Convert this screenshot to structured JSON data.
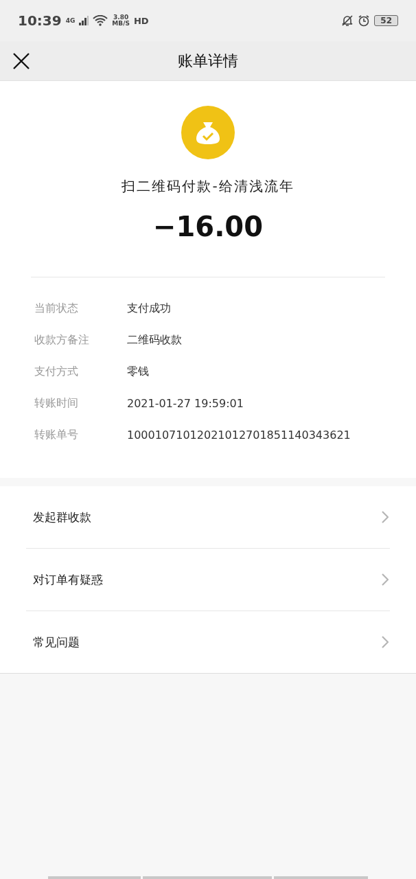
{
  "status_bar": {
    "time": "10:39",
    "network": "4G",
    "speed": "3.80",
    "speed_unit": "MB/S",
    "hd": "HD",
    "battery": "52"
  },
  "header": {
    "title": "账单详情"
  },
  "summary": {
    "description": "扫二维码付款-给清浅流年",
    "amount": "−16.00"
  },
  "details": [
    {
      "label": "当前状态",
      "value": "支付成功"
    },
    {
      "label": "收款方备注",
      "value": "二维码收款"
    },
    {
      "label": "支付方式",
      "value": "零钱"
    },
    {
      "label": "转账时间",
      "value": "2021-01-27 19:59:01"
    },
    {
      "label": "转账单号",
      "value": "10001071012021012701851140343621"
    }
  ],
  "menu": [
    {
      "label": "发起群收款"
    },
    {
      "label": "对订单有疑惑"
    },
    {
      "label": "常见问题"
    }
  ]
}
